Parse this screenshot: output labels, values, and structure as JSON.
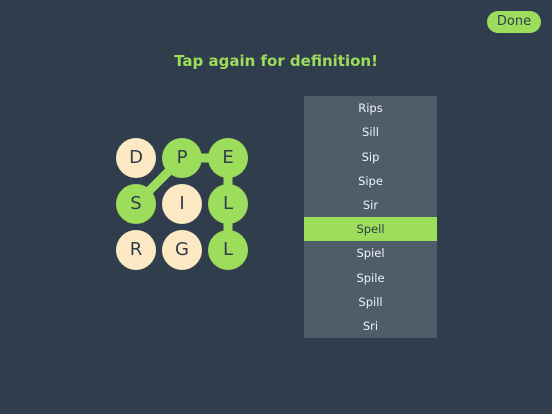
{
  "toolbar": {
    "done_label": "Done"
  },
  "hint": "Tap again for definition!",
  "board": {
    "rows": [
      [
        {
          "letter": "D",
          "selected": false
        },
        {
          "letter": "P",
          "selected": true
        },
        {
          "letter": "E",
          "selected": true
        }
      ],
      [
        {
          "letter": "S",
          "selected": true
        },
        {
          "letter": "I",
          "selected": false
        },
        {
          "letter": "L",
          "selected": true
        }
      ],
      [
        {
          "letter": "R",
          "selected": false
        },
        {
          "letter": "G",
          "selected": false
        },
        {
          "letter": "L",
          "selected": true
        }
      ]
    ],
    "path": [
      [
        1,
        0
      ],
      [
        0,
        1
      ],
      [
        0,
        2
      ],
      [
        1,
        2
      ],
      [
        2,
        2
      ]
    ]
  },
  "words": [
    "Rips",
    "Sill",
    "Sip",
    "Sipe",
    "Sir",
    "Spell",
    "Spiel",
    "Spile",
    "Spill",
    "Sri"
  ],
  "active_word_index": 5,
  "colors": {
    "background": "#2f3d4c",
    "accent": "#9ddd5c",
    "tile_unselected": "#fce9c3",
    "list_background": "#4f5d6b"
  }
}
